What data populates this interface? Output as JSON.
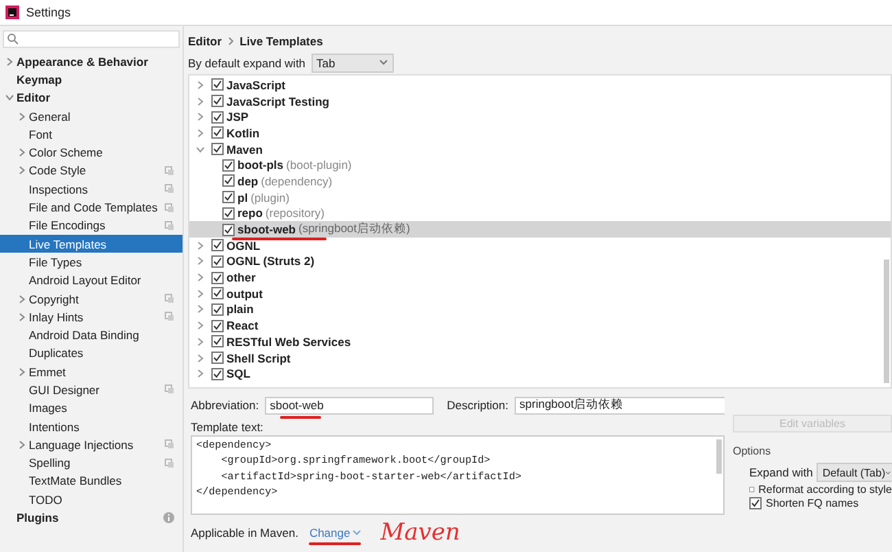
{
  "window": {
    "title": "Settings"
  },
  "sidebar": {
    "items": [
      {
        "label": "Appearance & Behavior",
        "expandable": true,
        "expanded": false,
        "selected": false,
        "scope_icon": false
      },
      {
        "label": "Keymap",
        "expandable": false,
        "expanded": false,
        "selected": false,
        "scope_icon": false
      },
      {
        "label": "Editor",
        "expandable": true,
        "expanded": true,
        "selected": false,
        "scope_icon": false,
        "children": [
          {
            "label": "General",
            "expandable": true,
            "expanded": false,
            "selected": false,
            "scope_icon": false
          },
          {
            "label": "Font",
            "expandable": false,
            "expanded": false,
            "selected": false,
            "scope_icon": false
          },
          {
            "label": "Color Scheme",
            "expandable": true,
            "expanded": false,
            "selected": false,
            "scope_icon": false
          },
          {
            "label": "Code Style",
            "expandable": true,
            "expanded": false,
            "selected": false,
            "scope_icon": true
          },
          {
            "label": "Inspections",
            "expandable": false,
            "expanded": false,
            "selected": false,
            "scope_icon": true
          },
          {
            "label": "File and Code Templates",
            "expandable": false,
            "expanded": false,
            "selected": false,
            "scope_icon": true
          },
          {
            "label": "File Encodings",
            "expandable": false,
            "expanded": false,
            "selected": false,
            "scope_icon": true
          },
          {
            "label": "Live Templates",
            "expandable": false,
            "expanded": false,
            "selected": true,
            "scope_icon": false
          },
          {
            "label": "File Types",
            "expandable": false,
            "expanded": false,
            "selected": false,
            "scope_icon": false
          },
          {
            "label": "Android Layout Editor",
            "expandable": false,
            "expanded": false,
            "selected": false,
            "scope_icon": false
          },
          {
            "label": "Copyright",
            "expandable": true,
            "expanded": false,
            "selected": false,
            "scope_icon": true
          },
          {
            "label": "Inlay Hints",
            "expandable": true,
            "expanded": false,
            "selected": false,
            "scope_icon": true
          },
          {
            "label": "Android Data Binding",
            "expandable": false,
            "expanded": false,
            "selected": false,
            "scope_icon": false
          },
          {
            "label": "Duplicates",
            "expandable": false,
            "expanded": false,
            "selected": false,
            "scope_icon": false
          },
          {
            "label": "Emmet",
            "expandable": true,
            "expanded": false,
            "selected": false,
            "scope_icon": false
          },
          {
            "label": "GUI Designer",
            "expandable": false,
            "expanded": false,
            "selected": false,
            "scope_icon": true
          },
          {
            "label": "Images",
            "expandable": false,
            "expanded": false,
            "selected": false,
            "scope_icon": false
          },
          {
            "label": "Intentions",
            "expandable": false,
            "expanded": false,
            "selected": false,
            "scope_icon": false
          },
          {
            "label": "Language Injections",
            "expandable": true,
            "expanded": false,
            "selected": false,
            "scope_icon": true
          },
          {
            "label": "Spelling",
            "expandable": false,
            "expanded": false,
            "selected": false,
            "scope_icon": true
          },
          {
            "label": "TextMate Bundles",
            "expandable": false,
            "expanded": false,
            "selected": false,
            "scope_icon": false
          },
          {
            "label": "TODO",
            "expandable": false,
            "expanded": false,
            "selected": false,
            "scope_icon": false
          }
        ]
      },
      {
        "label": "Plugins",
        "expandable": false,
        "expanded": false,
        "selected": false,
        "scope_icon": false,
        "info_icon": true
      }
    ]
  },
  "breadcrumb": [
    "Editor",
    "Live Templates"
  ],
  "expand_with": {
    "label": "By default expand with",
    "value": "Tab"
  },
  "templates": [
    {
      "name": "JavaScript",
      "checked": true,
      "expanded": false,
      "selected": false
    },
    {
      "name": "JavaScript Testing",
      "checked": true,
      "expanded": false,
      "selected": false
    },
    {
      "name": "JSP",
      "checked": true,
      "expanded": false,
      "selected": false
    },
    {
      "name": "Kotlin",
      "checked": true,
      "expanded": false,
      "selected": false
    },
    {
      "name": "Maven",
      "checked": true,
      "expanded": true,
      "selected": false,
      "children": [
        {
          "name": "boot-pls",
          "description": "(boot-plugin)",
          "checked": true,
          "selected": false
        },
        {
          "name": "dep",
          "description": "(dependency)",
          "checked": true,
          "selected": false
        },
        {
          "name": "pl",
          "description": "(plugin)",
          "checked": true,
          "selected": false
        },
        {
          "name": "repo",
          "description": "(repository)",
          "checked": true,
          "selected": false
        },
        {
          "name": "sboot-web",
          "description": "(springboot启动依赖)",
          "checked": true,
          "selected": true
        }
      ]
    },
    {
      "name": "OGNL",
      "checked": true,
      "expanded": false,
      "selected": false
    },
    {
      "name": "OGNL (Struts 2)",
      "checked": true,
      "expanded": false,
      "selected": false
    },
    {
      "name": "other",
      "checked": true,
      "expanded": false,
      "selected": false
    },
    {
      "name": "output",
      "checked": true,
      "expanded": false,
      "selected": false
    },
    {
      "name": "plain",
      "checked": true,
      "expanded": false,
      "selected": false
    },
    {
      "name": "React",
      "checked": true,
      "expanded": false,
      "selected": false
    },
    {
      "name": "RESTful Web Services",
      "checked": true,
      "expanded": false,
      "selected": false
    },
    {
      "name": "Shell Script",
      "checked": true,
      "expanded": false,
      "selected": false
    },
    {
      "name": "SQL",
      "checked": true,
      "expanded": false,
      "selected": false
    }
  ],
  "abbreviation": {
    "label": "Abbreviation:",
    "value": "sboot-web"
  },
  "description": {
    "label": "Description:",
    "value": "springboot启动依赖"
  },
  "template_text": {
    "label": "Template text:",
    "lines": [
      "<dependency>",
      "    <groupId>org.springframework.boot</groupId>",
      "    <artifactId>spring-boot-starter-web</artifactId>",
      "</dependency>"
    ]
  },
  "edit_variables": {
    "label": "Edit variables",
    "disabled": true
  },
  "options": {
    "title": "Options",
    "expand_with": {
      "label": "Expand with",
      "value": "Default (Tab)"
    },
    "checkboxes": [
      {
        "label": "Reformat according to style",
        "checked": false
      },
      {
        "label": "Shorten FQ names",
        "checked": true
      }
    ]
  },
  "applicable": {
    "text": "Applicable in Maven.",
    "link": "Change"
  },
  "handwritten_note": "Maven"
}
